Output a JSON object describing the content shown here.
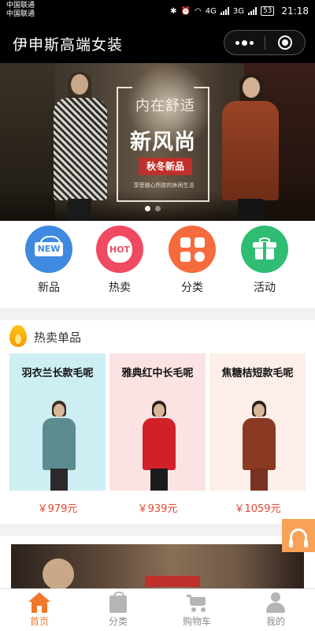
{
  "status_bar": {
    "carrier_1": "中国联通",
    "carrier_2": "中国联通",
    "network_1": "4G",
    "network_2": "3G",
    "battery": "53",
    "time": "21:18"
  },
  "nav": {
    "title": "伊申斯高端女装"
  },
  "banner": {
    "script_text": "内在舒适",
    "headline": "新风尚",
    "tag": "秋冬新品",
    "subtitle": "享受随心所欲的休闲生活",
    "dots": 2,
    "active_dot": 1
  },
  "categories": [
    {
      "label": "新品",
      "icon": "new-icon",
      "badge": "NEW",
      "color": "#3f8ae0"
    },
    {
      "label": "热卖",
      "icon": "hot-icon",
      "badge": "HOT",
      "color": "#f04a63"
    },
    {
      "label": "分类",
      "icon": "category-grid-icon",
      "color": "#f56b3e"
    },
    {
      "label": "活动",
      "icon": "gift-icon",
      "color": "#2fbd73"
    }
  ],
  "hot_section": {
    "title": "热卖单品",
    "products": [
      {
        "name": "羽衣兰长款毛呢",
        "price": "￥979元",
        "bg": "#cdeff3",
        "coat": "#5c8c8f",
        "pants": "#2a2a2a"
      },
      {
        "name": "雅典红中长毛呢",
        "price": "￥939元",
        "bg": "#fbe3e3",
        "coat": "#d2202a",
        "pants": "#1c1c1c"
      },
      {
        "name": "焦糖桔短款毛呢",
        "price": "￥1059元",
        "bg": "#fdeeea",
        "coat": "#8a3a22",
        "pants": "#7a3220"
      }
    ]
  },
  "tabs": [
    {
      "label": "首页",
      "icon": "home-icon",
      "active": true
    },
    {
      "label": "分类",
      "icon": "bag-icon",
      "active": false
    },
    {
      "label": "购物车",
      "icon": "cart-icon",
      "active": false
    },
    {
      "label": "我的",
      "icon": "person-icon",
      "active": false
    }
  ],
  "colors": {
    "accent": "#f0782a",
    "price": "#e8472f",
    "service": "#f7a256"
  }
}
